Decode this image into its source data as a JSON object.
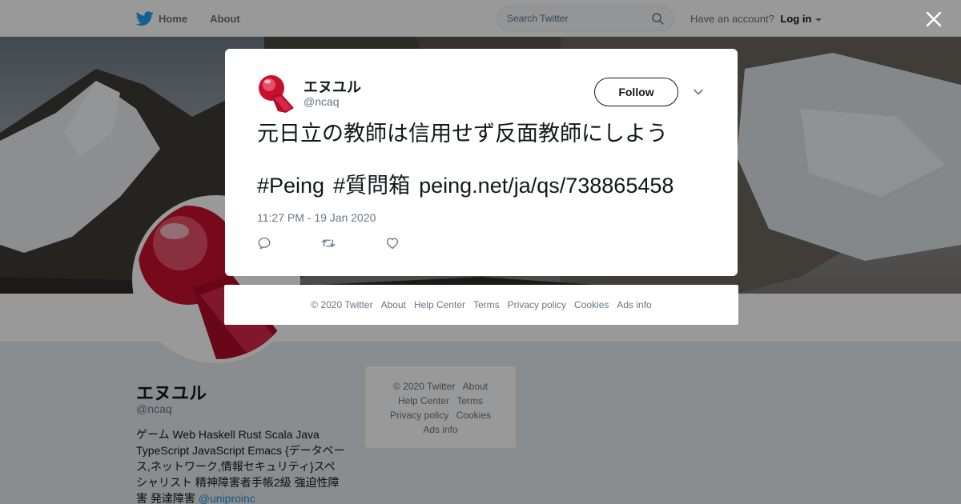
{
  "nav": {
    "home_label": "Home",
    "about_label": "About",
    "search_placeholder": "Search Twitter",
    "account_prompt": "Have an account?",
    "login_label": "Log in"
  },
  "profile": {
    "name": "エヌユル",
    "handle": "@ncaq",
    "bio": "ゲーム Web Haskell Rust Scala Java TypeScript JavaScript Emacs {データベース,ネットワーク,情報セキュリティ}スペシャリスト 精神障害者手帳2級 強迫性障害 発達障害",
    "bio_mention": "@uniproinc"
  },
  "side_footer": {
    "copyright": "© 2020 Twitter",
    "about": "About",
    "help": "Help Center",
    "terms": "Terms",
    "privacy": "Privacy policy",
    "cookies": "Cookies",
    "ads": "Ads info"
  },
  "tweet": {
    "name": "エヌユル",
    "handle": "@ncaq",
    "follow_label": "Follow",
    "text": "元日立の教師は信用せず反面教師にしよう",
    "hashtag1": "#Peing",
    "hashtag2": "#質問箱",
    "link": "peing.net/ja/qs/738865458",
    "timestamp": "11:27 PM - 19 Jan 2020"
  },
  "modal_footer": {
    "copyright": "© 2020 Twitter",
    "about": "About",
    "help": "Help Center",
    "terms": "Terms",
    "privacy": "Privacy policy",
    "cookies": "Cookies",
    "ads": "Ads info"
  },
  "colors": {
    "twitter_blue": "#1da1f2",
    "avatar_red": "#c8102e",
    "mention_blue": "#1b95e0",
    "muted_gray": "#657786"
  },
  "icons": [
    "twitter-bird-icon",
    "search-icon",
    "close-icon",
    "chevron-down-icon",
    "reply-icon",
    "retweet-icon",
    "like-icon"
  ]
}
